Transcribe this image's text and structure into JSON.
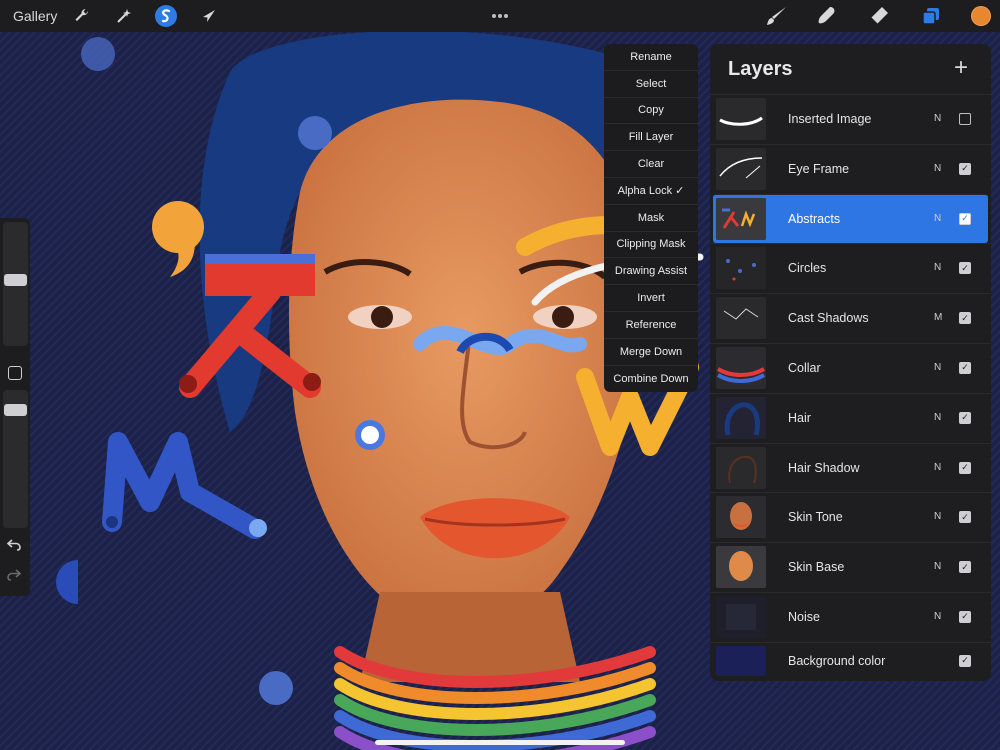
{
  "toolbar": {
    "gallery_label": "Gallery",
    "icons": [
      "wrench-icon",
      "magic-wand-icon",
      "selection-icon",
      "transform-arrow-icon",
      "more-dots-icon",
      "brush-icon",
      "smudge-icon",
      "eraser-icon",
      "layers-icon",
      "color-swatch"
    ],
    "current_color": "#e8872f",
    "accent_color": "#2f7be6"
  },
  "sidebar": {
    "brush_size_level": 0.55,
    "brush_opacity_level": 0.9,
    "undo_icon": "undo-icon",
    "redo_icon": "redo-icon"
  },
  "layer_menu": {
    "items": [
      {
        "label": "Rename"
      },
      {
        "label": "Select"
      },
      {
        "label": "Copy"
      },
      {
        "label": "Fill Layer"
      },
      {
        "label": "Clear"
      },
      {
        "label": "Alpha Lock ✓"
      },
      {
        "label": "Mask"
      },
      {
        "label": "Clipping Mask"
      },
      {
        "label": "Drawing Assist"
      },
      {
        "label": "Invert"
      },
      {
        "label": "Reference"
      },
      {
        "label": "Merge Down"
      },
      {
        "label": "Combine Down"
      }
    ]
  },
  "layers": {
    "title": "Layers",
    "add_label": "+",
    "active_color": "#2f76e5",
    "items": [
      {
        "name": "Inserted Image",
        "blend": "N",
        "visible": false
      },
      {
        "name": "Eye Frame",
        "blend": "N",
        "visible": true
      },
      {
        "name": "Abstracts",
        "blend": "N",
        "visible": true,
        "active": true
      },
      {
        "name": "Circles",
        "blend": "N",
        "visible": true
      },
      {
        "name": "Cast Shadows",
        "blend": "M",
        "visible": true
      },
      {
        "name": "Collar",
        "blend": "N",
        "visible": true
      },
      {
        "name": "Hair",
        "blend": "N",
        "visible": true
      },
      {
        "name": "Hair Shadow",
        "blend": "N",
        "visible": true
      },
      {
        "name": "Skin Tone",
        "blend": "N",
        "visible": true
      },
      {
        "name": "Skin Base",
        "blend": "N",
        "visible": true
      },
      {
        "name": "Noise",
        "blend": "N",
        "visible": true
      },
      {
        "name": "Background color",
        "blend": "",
        "visible": true
      }
    ]
  }
}
